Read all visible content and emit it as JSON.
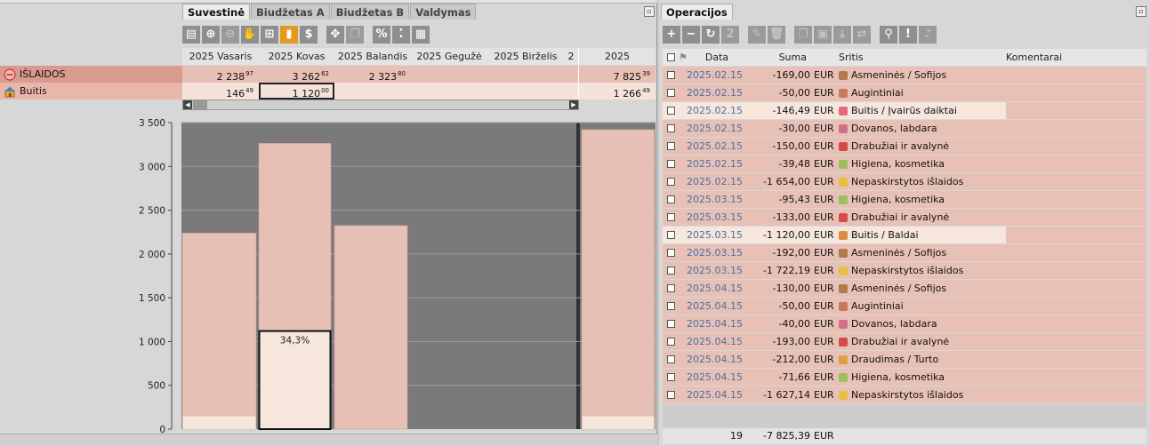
{
  "left": {
    "tabs": [
      "Suvestinė",
      "Biudžetas A",
      "Biudžetas B",
      "Valdymas"
    ],
    "active_tab": 0,
    "toolbar_icons": [
      "save-icon",
      "zoom-in-icon",
      "zoom-out-icon",
      "hand-icon",
      "tree-icon",
      "bar-chart-icon",
      "dollar-icon",
      "move-icon",
      "copy-icon",
      "percent-icon",
      "sort-icon",
      "calculator-icon"
    ],
    "columns": [
      "2025 Vasaris",
      "2025 Kovas",
      "2025 Balandis",
      "2025 Gegužė",
      "2025 Birželis",
      "2",
      "2025"
    ],
    "rows": [
      {
        "name": "IŠLAIDOS",
        "icon": "minus-circle-icon",
        "values": [
          {
            "main": "2 238",
            "dec": "97"
          },
          {
            "main": "3 262",
            "dec": "62"
          },
          {
            "main": "2 323",
            "dec": "80"
          },
          {
            "main": "",
            "dec": ""
          },
          {
            "main": "",
            "dec": ""
          },
          {
            "main": "",
            "dec": ""
          },
          {
            "main": "7 825",
            "dec": "39"
          }
        ]
      },
      {
        "name": "Buitis",
        "icon": "house-icon",
        "values": [
          {
            "main": "146",
            "dec": "49"
          },
          {
            "main": "1 120",
            "dec": "00"
          },
          {
            "main": "",
            "dec": ""
          },
          {
            "main": "",
            "dec": ""
          },
          {
            "main": "",
            "dec": ""
          },
          {
            "main": "",
            "dec": ""
          },
          {
            "main": "1 266",
            "dec": "49"
          }
        ]
      }
    ]
  },
  "chart_data": {
    "type": "bar",
    "categories": [
      "2025 Vasaris",
      "2025 Kovas",
      "2025 Balandis",
      "2025"
    ],
    "series": [
      {
        "values": [
          2238.97,
          3262.62,
          2323.8,
          7825.39
        ]
      },
      {
        "values": [
          146.49,
          1120.0,
          0,
          146.49
        ]
      }
    ],
    "yticks": [
      "3 500",
      "3 000",
      "2 500",
      "2 000",
      "1 500",
      "1 000",
      "500",
      "0"
    ],
    "ylim": [
      0,
      3500
    ],
    "annotation": "34,3%",
    "grid": true,
    "colors": {
      "plot_bg": "#7a7a7a",
      "bar": "#e6bfb5",
      "bar_inner": "#f6e6dc"
    }
  },
  "right": {
    "tab": "Operacijos",
    "toolbar_icons": [
      "plus-icon",
      "minus-icon",
      "undo-icon",
      "two-icon",
      "edit-icon",
      "trash-icon",
      "copy-icon",
      "paste-icon",
      "download-icon",
      "refresh-icon",
      "search-icon",
      "alert-icon",
      "bell-icon"
    ],
    "toolbar_text": {
      "two": "2",
      "alert": "!"
    },
    "headers": {
      "data": "Data",
      "suma": "Suma",
      "sritis": "Sritis",
      "komentarai": "Komentarai"
    },
    "operations": [
      {
        "date": "2025.02.15",
        "sum": "-169,00",
        "cur": "EUR",
        "cat": "Asmeninės / Sofijos",
        "color": "#b07a4a",
        "light": false
      },
      {
        "date": "2025.02.15",
        "sum": "-50,00",
        "cur": "EUR",
        "cat": "Augintiniai",
        "color": "#c87a5a",
        "light": false
      },
      {
        "date": "2025.02.15",
        "sum": "-146,49",
        "cur": "EUR",
        "cat": "Buitis / Įvairūs daiktai",
        "color": "#e06a7a",
        "light": true
      },
      {
        "date": "2025.02.15",
        "sum": "-30,00",
        "cur": "EUR",
        "cat": "Dovanos, labdara",
        "color": "#d07088",
        "light": false
      },
      {
        "date": "2025.02.15",
        "sum": "-150,00",
        "cur": "EUR",
        "cat": "Drabužiai ir avalynė",
        "color": "#d84a4a",
        "light": false
      },
      {
        "date": "2025.02.15",
        "sum": "-39,48",
        "cur": "EUR",
        "cat": "Higiena, kosmetika",
        "color": "#9ac060",
        "light": false
      },
      {
        "date": "2025.02.15",
        "sum": "-1 654,00",
        "cur": "EUR",
        "cat": "Nepaskirstytos išlaidos",
        "color": "#e8c040",
        "light": false
      },
      {
        "date": "2025.03.15",
        "sum": "-95,43",
        "cur": "EUR",
        "cat": "Higiena, kosmetika",
        "color": "#9ac060",
        "light": false
      },
      {
        "date": "2025.03.15",
        "sum": "-133,00",
        "cur": "EUR",
        "cat": "Drabužiai ir avalynė",
        "color": "#d84a4a",
        "light": false
      },
      {
        "date": "2025.03.15",
        "sum": "-1 120,00",
        "cur": "EUR",
        "cat": "Buitis / Baldai",
        "color": "#d89040",
        "light": true
      },
      {
        "date": "2025.03.15",
        "sum": "-192,00",
        "cur": "EUR",
        "cat": "Asmeninės / Sofijos",
        "color": "#b07a4a",
        "light": false
      },
      {
        "date": "2025.03.15",
        "sum": "-1 722,19",
        "cur": "EUR",
        "cat": "Nepaskirstytos išlaidos",
        "color": "#e8c040",
        "light": false
      },
      {
        "date": "2025.04.15",
        "sum": "-130,00",
        "cur": "EUR",
        "cat": "Asmeninės / Sofijos",
        "color": "#b07a4a",
        "light": false
      },
      {
        "date": "2025.04.15",
        "sum": "-50,00",
        "cur": "EUR",
        "cat": "Augintiniai",
        "color": "#c87a5a",
        "light": false
      },
      {
        "date": "2025.04.15",
        "sum": "-40,00",
        "cur": "EUR",
        "cat": "Dovanos, labdara",
        "color": "#d07088",
        "light": false
      },
      {
        "date": "2025.04.15",
        "sum": "-193,00",
        "cur": "EUR",
        "cat": "Drabužiai ir avalynė",
        "color": "#d84a4a",
        "light": false
      },
      {
        "date": "2025.04.15",
        "sum": "-212,00",
        "cur": "EUR",
        "cat": "Draudimas / Turto",
        "color": "#e0a040",
        "light": false
      },
      {
        "date": "2025.04.15",
        "sum": "-71,66",
        "cur": "EUR",
        "cat": "Higiena, kosmetika",
        "color": "#9ac060",
        "light": false
      },
      {
        "date": "2025.04.15",
        "sum": "-1 627,14",
        "cur": "EUR",
        "cat": "Nepaskirstytos išlaidos",
        "color": "#e8c040",
        "light": false
      }
    ],
    "footer": {
      "count": "19",
      "total": "-7 825,39",
      "cur": "EUR"
    }
  }
}
